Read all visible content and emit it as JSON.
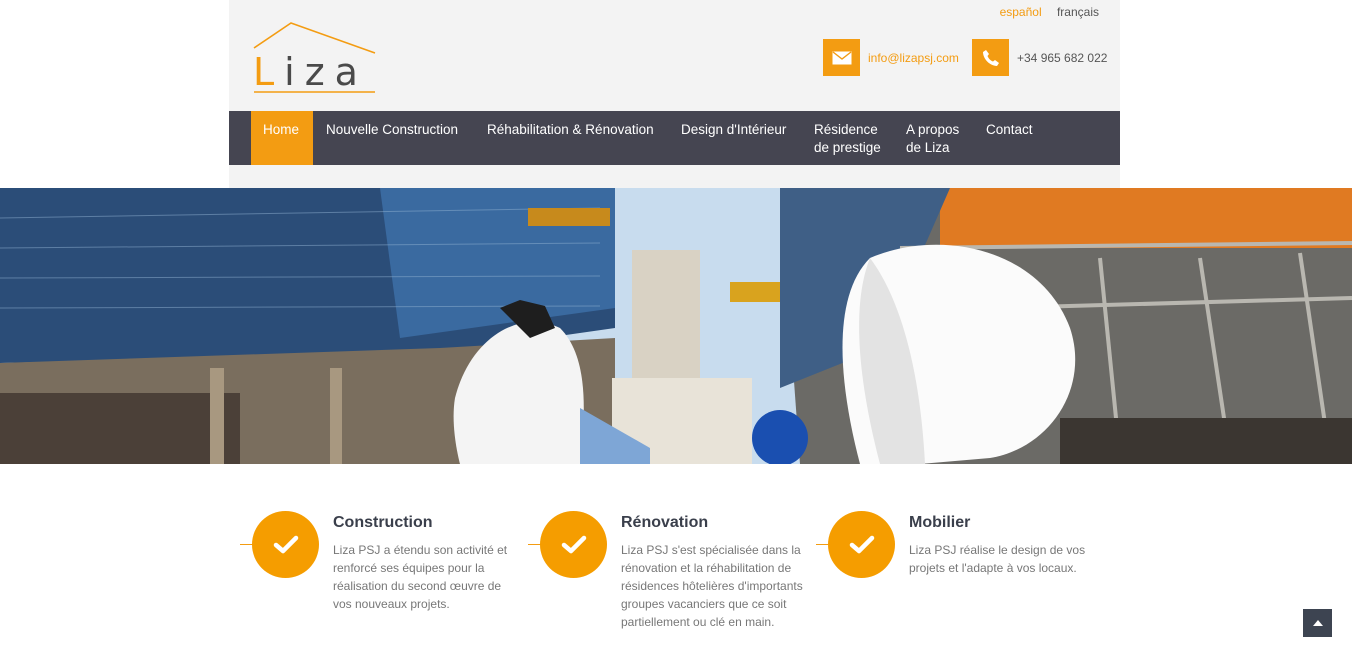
{
  "header": {
    "logo_text_first": "L",
    "logo_text_rest": "iza",
    "languages": [
      "español",
      "français"
    ],
    "email": "info@lizapsj.com",
    "phone": "+34 965 682 022"
  },
  "nav": {
    "items": [
      {
        "label": "Home",
        "active": true
      },
      {
        "label": "Nouvelle Construction"
      },
      {
        "label": "Réhabilitation & Rénovation"
      },
      {
        "label": "Design d'Intérieur"
      },
      {
        "label": "Résidence de prestige"
      },
      {
        "label": "A propos de Liza"
      },
      {
        "label": "Contact"
      }
    ]
  },
  "features": [
    {
      "title": "Construction",
      "text": "Liza PSJ a étendu son activité et renforcé ses équipes pour la réalisation du second œuvre de vos nouveaux projets."
    },
    {
      "title": "Rénovation",
      "text": "Liza PSJ s'est spécialisée dans la rénovation et la réhabilitation de résidences hôtelières d'importants groupes vacanciers que ce soit partiellement ou clé en main."
    },
    {
      "title": "Mobilier",
      "text": "Liza PSJ réalise le design de vos projets et l'adapte à vos locaux."
    }
  ],
  "icons": {
    "email": "envelope-icon",
    "phone": "phone-icon",
    "feature": "checkmark-icon",
    "totop": "chevron-up-icon"
  },
  "colors": {
    "accent": "#f39c12",
    "nav_bg": "#454551",
    "heading": "#3a3f4b"
  }
}
